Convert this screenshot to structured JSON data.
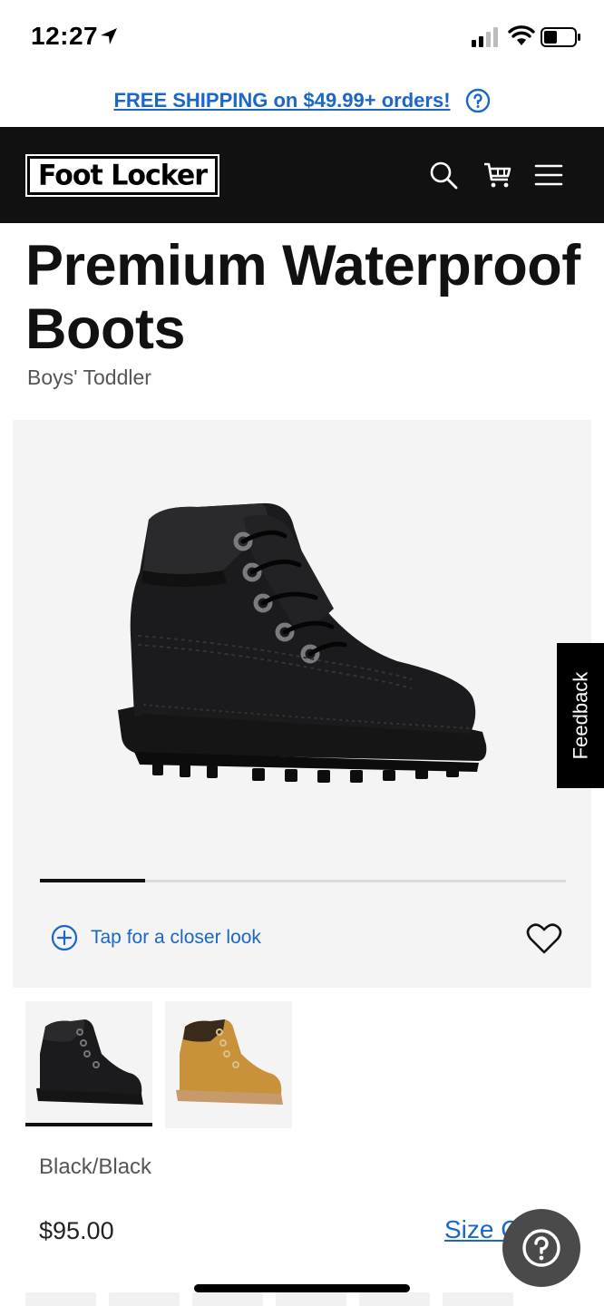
{
  "status_bar": {
    "time": "12:27"
  },
  "promo": {
    "text": "FREE SHIPPING on $49.99+ orders!"
  },
  "header": {
    "logo": "Foot Locker"
  },
  "product": {
    "title": "Premium Waterproof Boots",
    "subtitle": "Boys' Toddler",
    "closer_look": "Tap for a closer look",
    "image_progress": 0.2,
    "color_name": "Black/Black",
    "price": "$95.00",
    "size_chart": "Size C"
  },
  "thumbnails": [
    {
      "color": "#1a1a1a",
      "selected": true
    },
    {
      "color": "#c8913a",
      "selected": false
    }
  ],
  "feedback": {
    "label": "Feedback"
  },
  "colors": {
    "link": "#1a67c6",
    "header_bg": "#111111",
    "image_bg": "#f4f4f5"
  },
  "icons": [
    "location-arrow-icon",
    "signal-icon",
    "wifi-icon",
    "battery-icon",
    "help-icon",
    "search-icon",
    "cart-icon",
    "menu-icon",
    "plus-circle-icon",
    "heart-icon"
  ]
}
